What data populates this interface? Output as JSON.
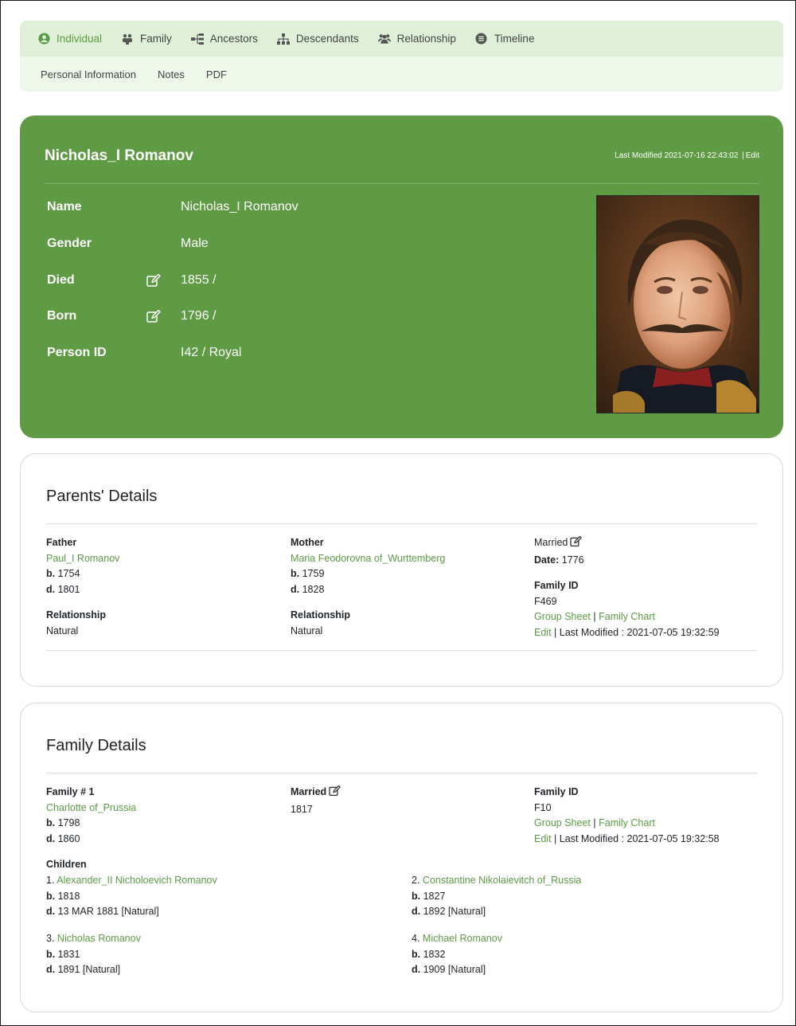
{
  "nav": {
    "tabs": [
      {
        "label": "Individual",
        "icon": "user-circle-icon"
      },
      {
        "label": "Family",
        "icon": "users-icon"
      },
      {
        "label": "Ancestors",
        "icon": "tree-ancestors-icon"
      },
      {
        "label": "Descendants",
        "icon": "sitemap-icon"
      },
      {
        "label": "Relationship",
        "icon": "group-icon"
      },
      {
        "label": "Timeline",
        "icon": "timeline-icon"
      }
    ],
    "subtabs": [
      "Personal Information",
      "Notes",
      "PDF"
    ]
  },
  "person": {
    "title": "Nicholas_I Romanov",
    "last_modified": "Last Modified 2021-07-16 22:43:02",
    "edit_label": "Edit",
    "fields": [
      {
        "label": "Name",
        "value": "Nicholas_I Romanov"
      },
      {
        "label": "Gender",
        "value": "Male"
      },
      {
        "label": "Died",
        "value": "1855 /"
      },
      {
        "label": "Born",
        "value": "1796 /"
      },
      {
        "label": "Person ID",
        "value": "I42 / Royal"
      }
    ]
  },
  "parents": {
    "title": "Parents' Details",
    "father_label": "Father",
    "father_name": "Paul_I Romanov",
    "father_b": "1754",
    "father_d": "1801",
    "father_rel_label": "Relationship",
    "father_rel": "Natural",
    "mother_label": "Mother",
    "mother_name": "Maria Feodorovna of_Wurttemberg",
    "mother_b": "1759",
    "mother_d": "1828",
    "mother_rel_label": "Relationship",
    "mother_rel": "Natural",
    "married_label": "Married",
    "date_label": "Date:",
    "date_value": "1776",
    "family_id_label": "Family ID",
    "family_id": "F469",
    "group_sheet": "Group Sheet",
    "family_chart": "Family Chart",
    "edit": "Edit",
    "last_modified": "Last Modified : 2021-07-05 19:32:59"
  },
  "family": {
    "title": "Family Details",
    "family_label": "Family # 1",
    "spouse_name": "Charlotte of_Prussia",
    "spouse_b": "1798",
    "spouse_d": "1860",
    "married_label": "Married",
    "married_value": "1817",
    "family_id_label": "Family ID",
    "family_id": "F10",
    "group_sheet": "Group Sheet",
    "family_chart": "Family Chart",
    "edit": "Edit",
    "last_modified": "Last Modified : 2021-07-05 19:32:58",
    "children_label": "Children",
    "children": [
      {
        "num": "1.",
        "name": "Alexander_II Nicholoevich Romanov",
        "b": "1818",
        "d": "13 MAR 1881 [Natural]"
      },
      {
        "num": "2.",
        "name": "Constantine Nikolaievitch of_Russia",
        "b": "1827",
        "d": "1892 [Natural]"
      },
      {
        "num": "3.",
        "name": "Nicholas Romanov",
        "b": "1831",
        "d": "1891 [Natural]"
      },
      {
        "num": "4.",
        "name": "Michael Romanov",
        "b": "1832",
        "d": "1909 [Natural]"
      }
    ]
  },
  "labels": {
    "b": "b.",
    "d": "d.",
    "pipe": "|"
  },
  "colors": {
    "accent": "#5f9b45",
    "link": "#5b9a45",
    "nav_bg": "#e0f0d8",
    "subnav_bg": "#eef8ea"
  }
}
